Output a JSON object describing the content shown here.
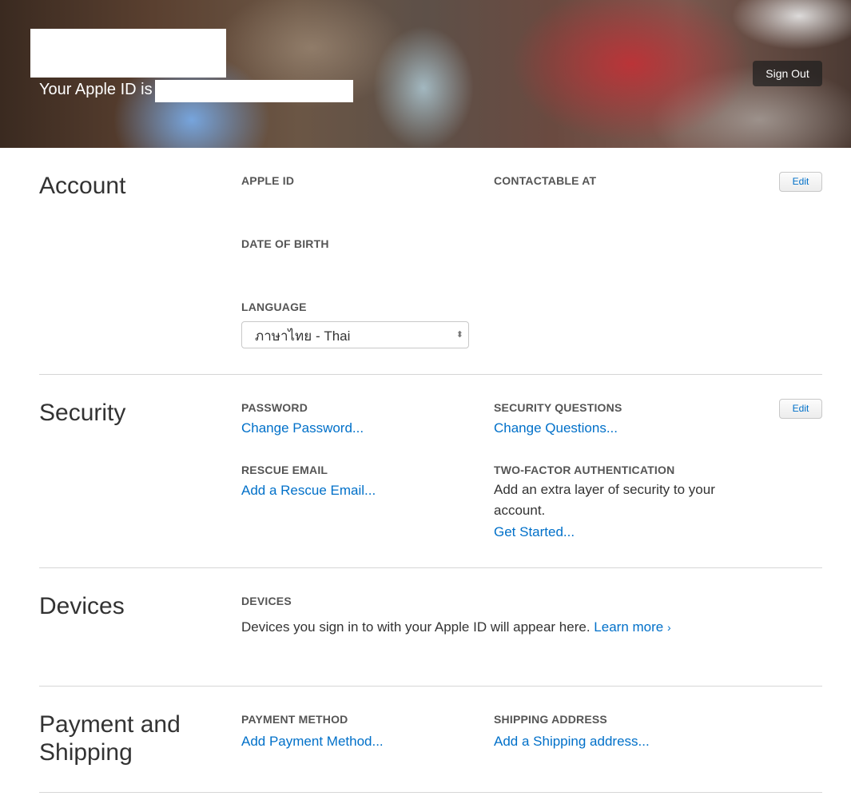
{
  "header": {
    "apple_id_prefix": "Your Apple ID is",
    "sign_out_label": "Sign Out"
  },
  "account": {
    "title": "Account",
    "apple_id_label": "APPLE ID",
    "contactable_label": "CONTACTABLE AT",
    "dob_label": "DATE OF BIRTH",
    "language_label": "LANGUAGE",
    "language_value": "ภาษาไทย - Thai",
    "edit_label": "Edit"
  },
  "security": {
    "title": "Security",
    "password_label": "PASSWORD",
    "password_link": "Change Password...",
    "questions_label": "SECURITY QUESTIONS",
    "questions_link": "Change Questions...",
    "rescue_label": "RESCUE EMAIL",
    "rescue_link": "Add a Rescue Email...",
    "twofactor_label": "TWO-FACTOR AUTHENTICATION",
    "twofactor_text_line1": "Add an extra layer of security to your",
    "twofactor_text_line2": "account.",
    "twofactor_link": "Get Started...",
    "edit_label": "Edit"
  },
  "devices": {
    "title": "Devices",
    "devices_label": "DEVICES",
    "description": "Devices you sign in to with your Apple ID will appear here.",
    "learn_more": "Learn more"
  },
  "payment": {
    "title_line1": "Payment and",
    "title_line2": "Shipping",
    "method_label": "PAYMENT METHOD",
    "method_link": "Add Payment Method...",
    "shipping_label": "SHIPPING ADDRESS",
    "shipping_link": "Add a Shipping address..."
  }
}
